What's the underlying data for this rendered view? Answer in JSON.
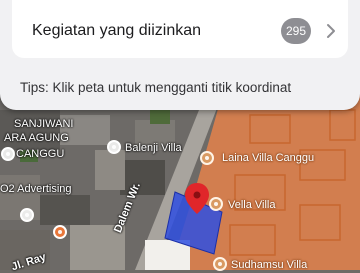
{
  "permissions": {
    "label": "Kegiatan yang diizinkan",
    "count": "295"
  },
  "tips": "Tips: Klik peta untuk mengganti titik koordinat",
  "map": {
    "zone_color": "#e8834a",
    "selection_color": "#2f4fe0",
    "marker_color": "#e0262a",
    "labels": {
      "sanjiwani": "SANJIWANI",
      "ara_agung": "ARA AGUNG",
      "canggu": "CANGGU",
      "balenji": "Balenji Villa",
      "laina": "Laina Villa Canggu",
      "vella": "Vella Villa",
      "advertising": "O2 Advertising",
      "sudhamsu": "Sudhamsu Villa",
      "dalem": "Dalem Wr.",
      "jl_ray": "Jl. Ray"
    }
  }
}
